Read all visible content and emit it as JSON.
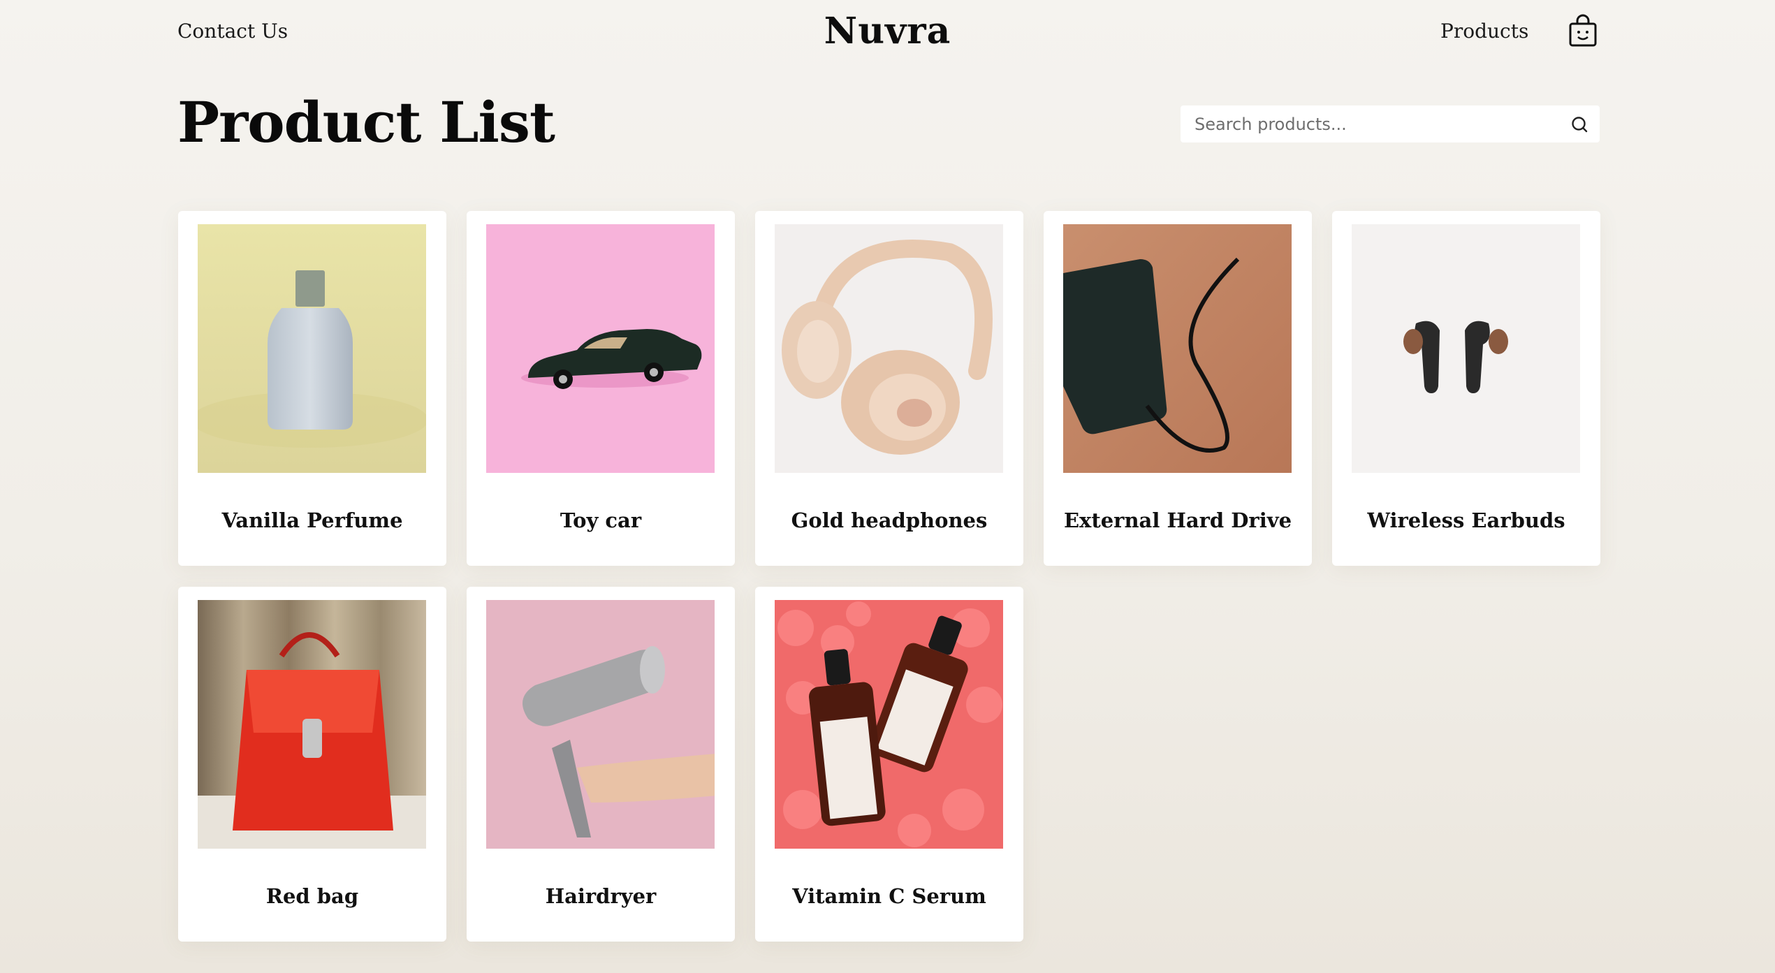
{
  "header": {
    "contact_label": "Contact Us",
    "brand": "Nuvra",
    "products_label": "Products",
    "cart_icon": "shopping-bag-icon"
  },
  "main": {
    "title": "Product List",
    "search": {
      "placeholder": "Search products...",
      "value": "",
      "icon": "search-icon"
    }
  },
  "products": [
    {
      "name": "Vanilla Perfume"
    },
    {
      "name": "Toy car"
    },
    {
      "name": "Gold headphones"
    },
    {
      "name": "External Hard Drive"
    },
    {
      "name": "Wireless Earbuds"
    },
    {
      "name": "Red bag"
    },
    {
      "name": "Hairdryer"
    },
    {
      "name": "Vitamin C Serum"
    }
  ]
}
